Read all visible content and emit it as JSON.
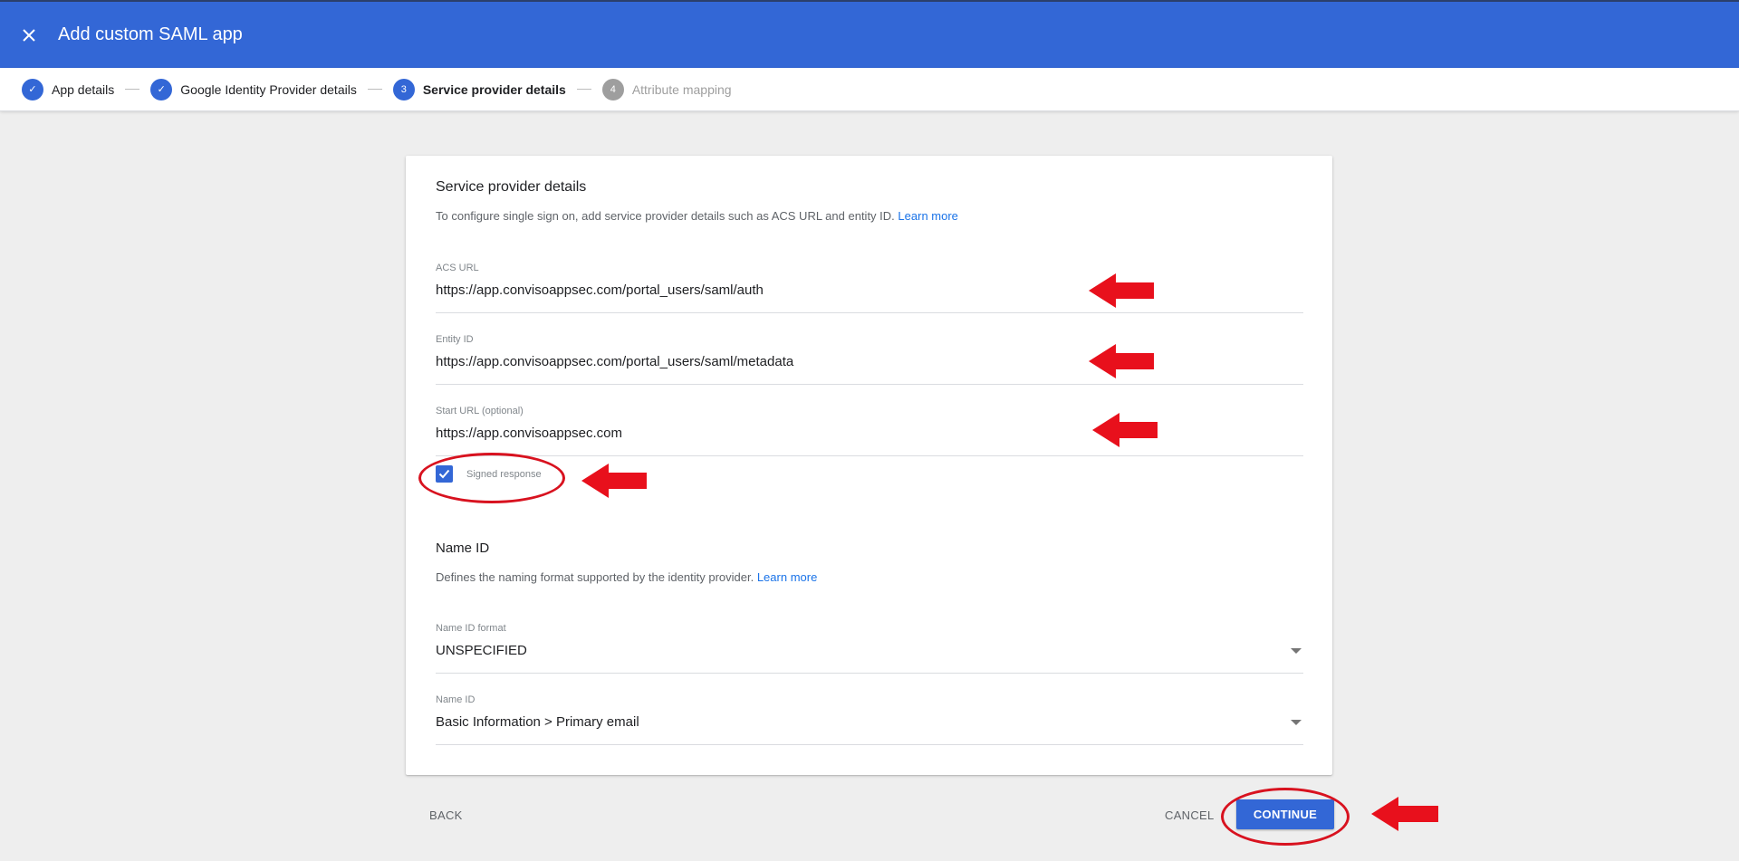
{
  "appbar": {
    "title": "Add custom SAML app",
    "close_icon": "close-icon"
  },
  "stepper": {
    "steps": [
      {
        "label": "App details",
        "state": "done",
        "marker": "✓"
      },
      {
        "label": "Google Identity Provider details",
        "state": "done",
        "marker": "✓"
      },
      {
        "label": "Service provider details",
        "state": "active",
        "marker": "3"
      },
      {
        "label": "Attribute mapping",
        "state": "pending",
        "marker": "4"
      }
    ]
  },
  "sp_section": {
    "title": "Service provider details",
    "description": "To configure single sign on, add service provider details such as ACS URL and entity ID.",
    "learn_more": "Learn more",
    "fields": [
      {
        "label": "ACS URL",
        "value": "https://app.convisoappsec.com/portal_users/saml/auth"
      },
      {
        "label": "Entity ID",
        "value": "https://app.convisoappsec.com/portal_users/saml/metadata"
      },
      {
        "label": "Start URL (optional)",
        "value": "https://app.convisoappsec.com"
      }
    ],
    "signed_response": {
      "label": "Signed response",
      "checked": true
    }
  },
  "nameid_section": {
    "title": "Name ID",
    "description": "Defines the naming format supported by the identity provider.",
    "learn_more": "Learn more",
    "fields": [
      {
        "label": "Name ID format",
        "value": "UNSPECIFIED"
      },
      {
        "label": "Name ID",
        "value": "Basic Information > Primary email"
      }
    ]
  },
  "footer": {
    "back": "BACK",
    "cancel": "CANCEL",
    "continue": "CONTINUE"
  },
  "colors": {
    "brand_blue": "#3367d6",
    "annotation_red": "#d8121f"
  }
}
